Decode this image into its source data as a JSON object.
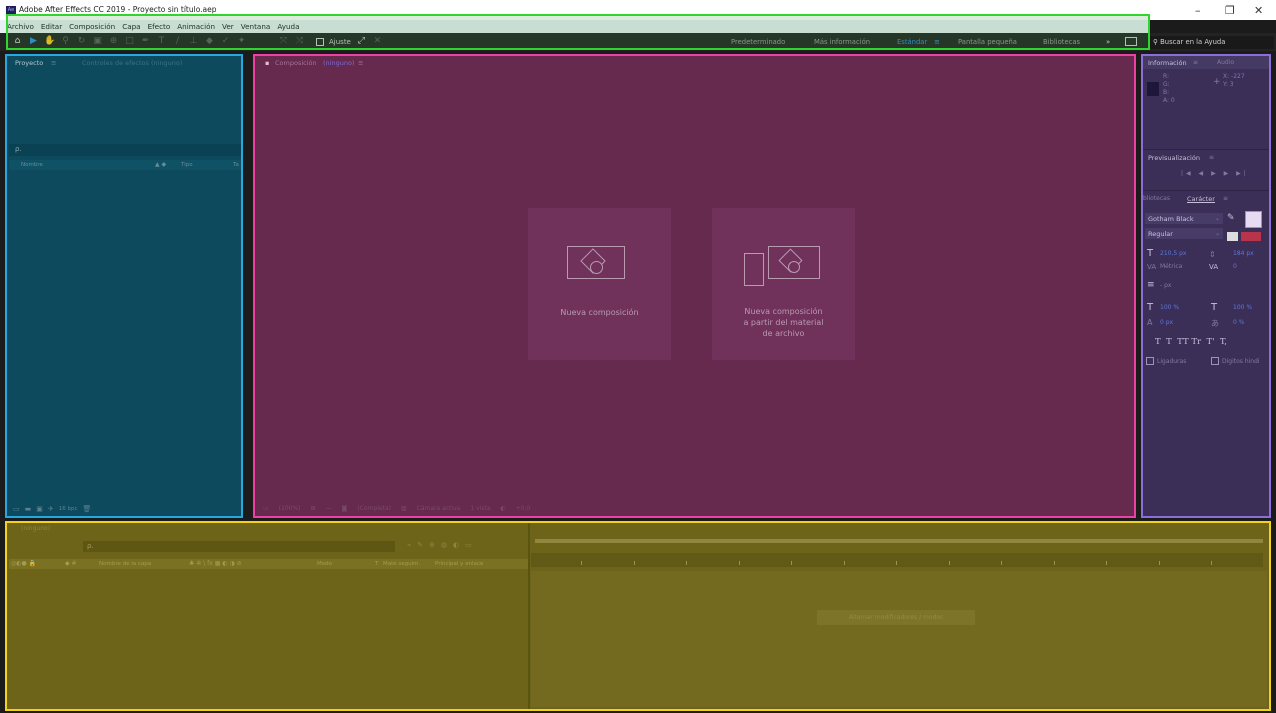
{
  "window": {
    "title": "Adobe After Effects CC 2019 - Proyecto sin título.aep",
    "logo": "Ae",
    "minimize": "–",
    "maximize": "❐",
    "close": "✕"
  },
  "menu": [
    "Archivo",
    "Editar",
    "Composición",
    "Capa",
    "Efecto",
    "Animación",
    "Ver",
    "Ventana",
    "Ayuda"
  ],
  "toolbar": {
    "ajuste": "Ajuste",
    "workspaces": [
      "Predeterminado",
      "Más información",
      "Estándar",
      "Pantalla pequeña",
      "Bibliotecas"
    ],
    "active_workspace": "Estándar",
    "more": "»",
    "search": "Buscar en la Ayuda"
  },
  "project": {
    "tab": "Proyecto",
    "tab_menu": "≡",
    "effects_tab": "Controles de efectos (ninguno)",
    "search_placeholder": "ρ.",
    "col_name": "Nombre",
    "col_type": "Tipo",
    "col_size": "Ta",
    "bpc": "16 bpc"
  },
  "composition": {
    "tab_prefix": "Composición",
    "tab_value": "(ninguno)",
    "tab_menu": "≡",
    "new_comp": "Nueva composición",
    "new_comp_footage": [
      "Nueva composición",
      "a partir del material",
      "de archivo"
    ],
    "footer_zoom": "(100%)",
    "footer_res": "(Completa)",
    "footer_camera": "Cámara activa",
    "footer_views": "1 vista",
    "footer_exposure": "+0,0"
  },
  "info": {
    "tab": "Información",
    "tab_menu": "≡",
    "audio_tab": "Audio",
    "r": "R:",
    "g": "G:",
    "b": "B:",
    "a": "A: 0",
    "x": "X: -227",
    "y": "Y: 3"
  },
  "preview": {
    "tab": "Previsualización",
    "tab_menu": "≡"
  },
  "character": {
    "libraries_tab": "bliotecas",
    "tab": "Carácter",
    "tab_menu": "≡",
    "font": "Gotham Black",
    "style": "Regular",
    "size": "210,5 px",
    "leading": "184 px",
    "kerning": "Métrica",
    "tracking": "0",
    "stroke": "- px",
    "vscale": "100 %",
    "hscale": "100 %",
    "baseline": "0 px",
    "tsume": "0 %",
    "styles": "T  T  TT Tr  T'  T,",
    "ligatures": "Ligaduras",
    "hindi": "Dígitos hindi",
    "fill_color": "#e6dbf2"
  },
  "timeline": {
    "tab": "(ninguno)",
    "search_placeholder": "ρ.",
    "col_layer": "Nombre de la capa",
    "col_mode": "Modo",
    "col_t": "T",
    "col_matte": "Mate seguim.",
    "col_parent": "Principal y enlace",
    "col_switches": "♣ ✲ \\ fx ▦ ◐ ◑ ⊘",
    "toggle_label": "Alternar modificadores / modos"
  },
  "colors": {
    "green": "#2fd52f",
    "blue": "#27a6e0",
    "pink": "#ee3fa5",
    "purple": "#8d6ed8",
    "yellow": "#f2d318",
    "accent": "#2e8bdf"
  }
}
